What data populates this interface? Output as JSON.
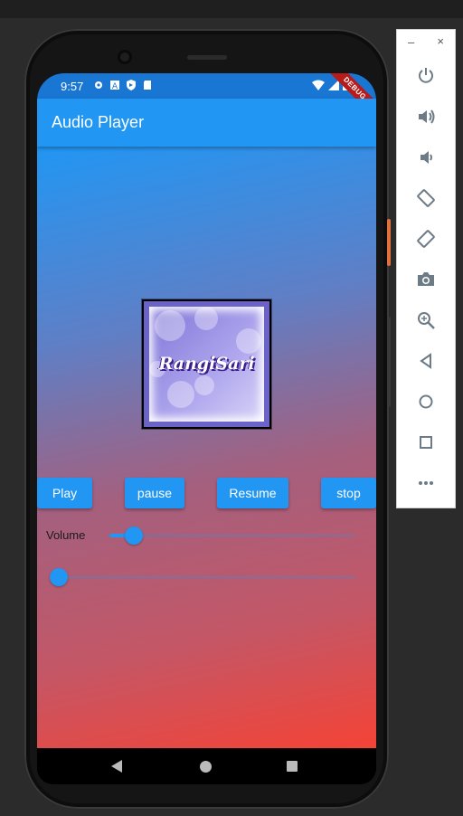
{
  "status_bar": {
    "time": "9:57",
    "debug_banner": "DEBUG"
  },
  "app_bar": {
    "title": "Audio Player"
  },
  "album_art": {
    "logo_text": "RangiSari"
  },
  "controls": {
    "play_label": "Play",
    "pause_label": "pause",
    "resume_label": "Resume",
    "stop_label": "stop"
  },
  "volume": {
    "label": "Volume",
    "value": 0.1
  },
  "seek": {
    "value": 0.0
  },
  "emulator_toolbar": {
    "minimize": "–",
    "close": "×",
    "items": [
      "power-icon",
      "volume-up-icon",
      "volume-down-icon",
      "rotate-left-icon",
      "rotate-right-icon",
      "camera-icon",
      "zoom-icon",
      "back-icon",
      "home-icon",
      "overview-icon",
      "more-icon"
    ]
  },
  "colors": {
    "primary": "#2196f3",
    "status_bar": "#1976d2",
    "gradient_top": "#2196f3",
    "gradient_bottom": "#f44336"
  }
}
